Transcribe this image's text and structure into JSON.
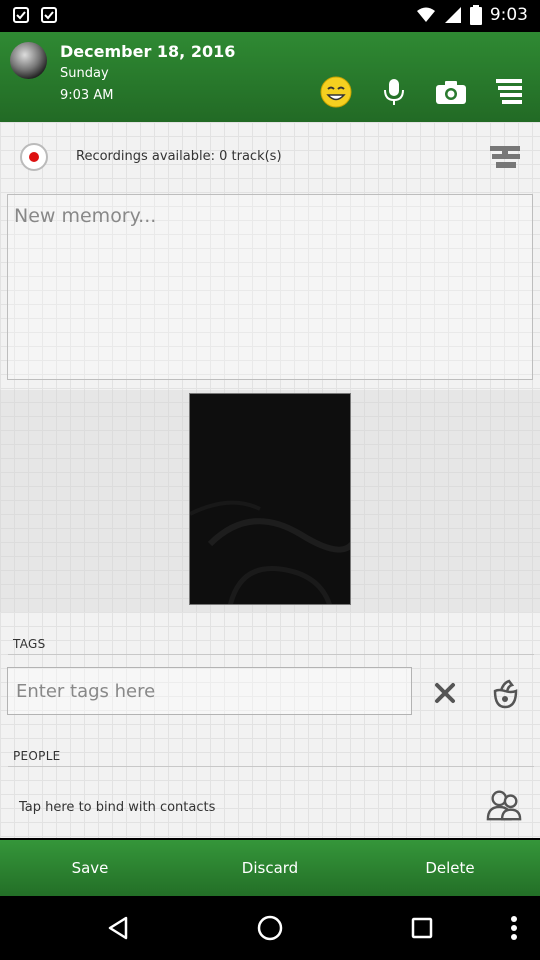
{
  "status_bar": {
    "time": "9:03"
  },
  "header": {
    "date": "December 18, 2016",
    "day": "Sunday",
    "time": "9:03 AM",
    "icons": [
      "emoji-icon",
      "microphone-icon",
      "camera-icon",
      "menu-icon"
    ]
  },
  "recordings": {
    "text": "Recordings available: 0 track(s)"
  },
  "memory": {
    "placeholder": "New memory...",
    "value": ""
  },
  "tags": {
    "label": "TAGS",
    "placeholder": "Enter tags here",
    "value": ""
  },
  "people": {
    "label": "PEOPLE",
    "bind_text": "Tap here to bind with contacts"
  },
  "actions": {
    "save": "Save",
    "discard": "Discard",
    "delete": "Delete"
  },
  "colors": {
    "header_green": "#2f8a33",
    "action_green": "#35963a",
    "record_red": "#dd1111"
  }
}
